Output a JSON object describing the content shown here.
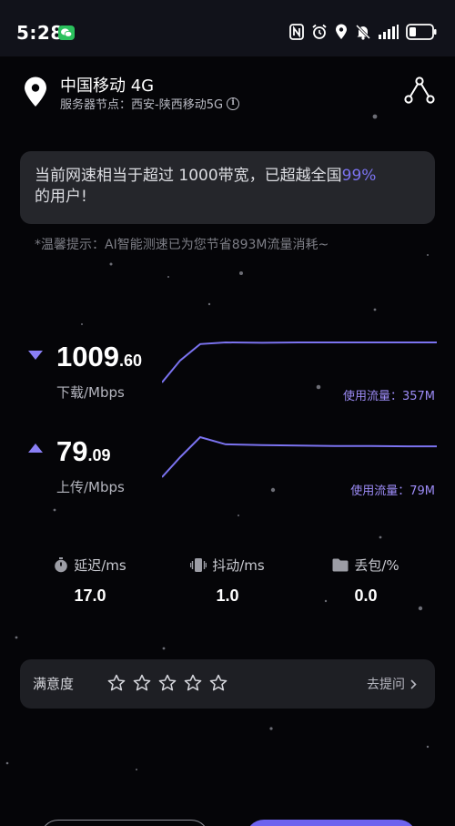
{
  "status_bar": {
    "time": "5:28",
    "icons": [
      "wechat-icon",
      "nfc-icon",
      "alarm-icon",
      "location-icon",
      "mute-icon",
      "signal-icon",
      "battery-icon"
    ]
  },
  "header": {
    "carrier": "中国移动 4G",
    "server_node": "服务器节点：西安-陕西移动5G",
    "info_glyph": "i"
  },
  "summary": {
    "text_before": "当前网速相当于超过 1000带宽，已超越全国",
    "percent": "99%",
    "text_after": "的用户!"
  },
  "tip": "*温馨提示：AI智能测速已为您节省893M流量消耗~",
  "download": {
    "value_int": "1009",
    "value_dec": ".60",
    "unit": "下载/Mbps",
    "usage": "使用流量：357M",
    "curve": [
      0.0,
      0.55,
      0.96,
      1.0,
      0.99,
      1.0,
      1.0,
      1.0,
      1.0,
      1.0
    ]
  },
  "upload": {
    "value_int": "79",
    "value_dec": ".09",
    "unit": "上传/Mbps",
    "usage": "使用流量：79M",
    "curve": [
      0.0,
      0.5,
      1.0,
      0.82,
      0.8,
      0.79,
      0.78,
      0.78,
      0.77,
      0.77
    ]
  },
  "metrics": {
    "latency": {
      "label": "延迟/ms",
      "value": "17.0",
      "icon": "stopwatch-icon"
    },
    "jitter": {
      "label": "抖动/ms",
      "value": "1.0",
      "icon": "vibrate-icon"
    },
    "loss": {
      "label": "丢包/%",
      "value": "0.0",
      "icon": "folder-icon"
    }
  },
  "satisfaction": {
    "label": "满意度",
    "stars": 5,
    "rating": 0,
    "ask": "去提问"
  },
  "colors": {
    "accent": "#7b73f0",
    "usage": "#9d8cf7",
    "background": "#050508",
    "card": "#25262b"
  }
}
